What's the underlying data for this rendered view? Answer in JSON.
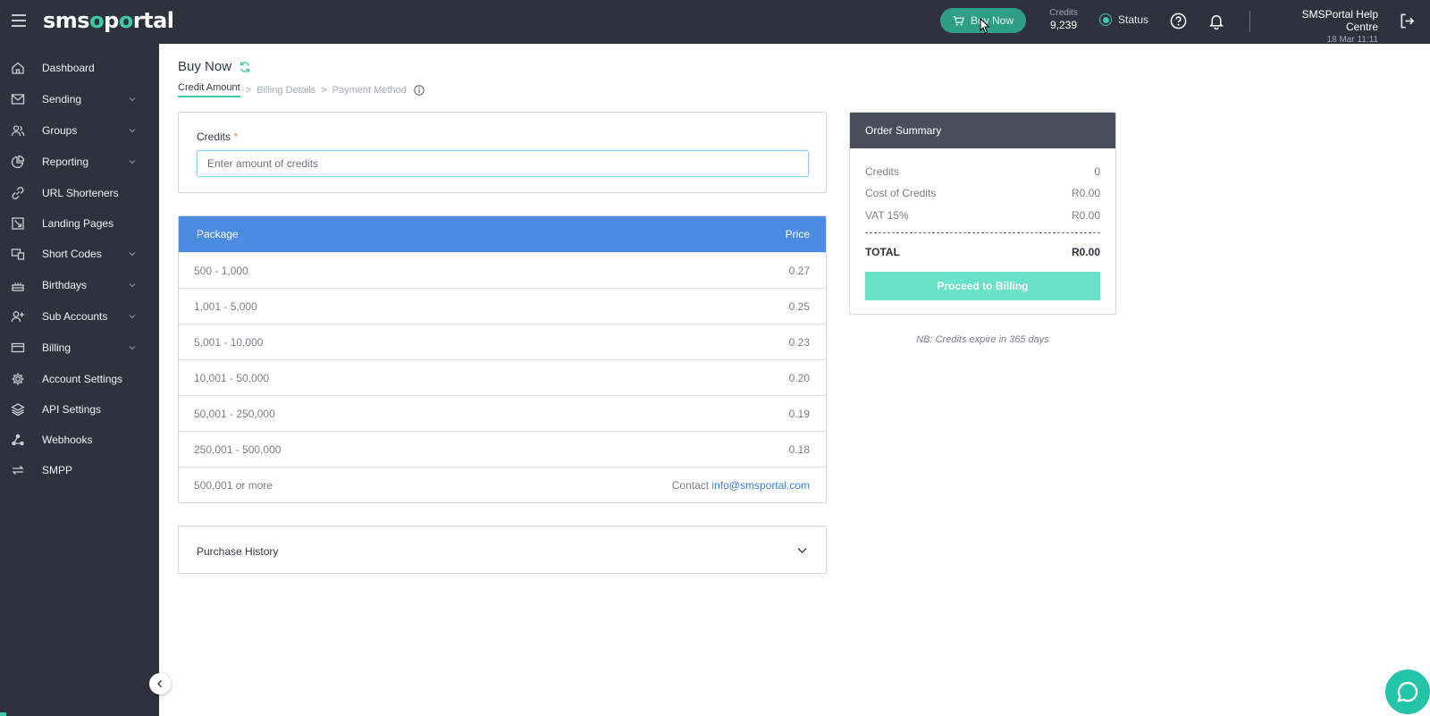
{
  "header": {
    "logo_left": "sms",
    "logo_o": "o",
    "logo_mid": "p",
    "logo_right": "rtal",
    "buy_now_label": "Buy Now",
    "credits_label": "Credits",
    "credits_value": "9,239",
    "status_label": "Status",
    "help_centre_title": "SMSPortal Help Centre",
    "help_centre_date": "18 Mar 11:11"
  },
  "sidebar": {
    "items": [
      {
        "label": "Dashboard",
        "icon": "home-icon",
        "has_children": false
      },
      {
        "label": "Sending",
        "icon": "envelope-icon",
        "has_children": true
      },
      {
        "label": "Groups",
        "icon": "users-icon",
        "has_children": true
      },
      {
        "label": "Reporting",
        "icon": "pie-chart-icon",
        "has_children": true
      },
      {
        "label": "URL Shorteners",
        "icon": "link-icon",
        "has_children": false
      },
      {
        "label": "Landing Pages",
        "icon": "landing-page-icon",
        "has_children": false
      },
      {
        "label": "Short Codes",
        "icon": "short-codes-icon",
        "has_children": true
      },
      {
        "label": "Birthdays",
        "icon": "cake-icon",
        "has_children": true
      },
      {
        "label": "Sub Accounts",
        "icon": "user-plus-icon",
        "has_children": true
      },
      {
        "label": "Billing",
        "icon": "credit-card-icon",
        "has_children": true
      },
      {
        "label": "Account Settings",
        "icon": "gear-icon",
        "has_children": false
      },
      {
        "label": "API Settings",
        "icon": "layers-icon",
        "has_children": false
      },
      {
        "label": "Webhooks",
        "icon": "webhooks-icon",
        "has_children": false
      },
      {
        "label": "SMPP",
        "icon": "swap-icon",
        "has_children": false
      }
    ]
  },
  "page": {
    "title": "Buy Now",
    "steps": [
      "Credit Amount",
      "Billing Details",
      "Payment Method"
    ],
    "separator": ">",
    "active_step": 0
  },
  "credits_form": {
    "label": "Credits",
    "required_mark": "*",
    "placeholder": "Enter amount of credits",
    "value": ""
  },
  "packages": {
    "header_package": "Package",
    "header_price": "Price",
    "rows": [
      {
        "range": "500 - 1,000",
        "price": "0.27"
      },
      {
        "range": "1,001 - 5,000",
        "price": "0.25"
      },
      {
        "range": "5,001 - 10,000",
        "price": "0.23"
      },
      {
        "range": "10,001 - 50,000",
        "price": "0.20"
      },
      {
        "range": "50,001 - 250,000",
        "price": "0.19"
      },
      {
        "range": "250,001 - 500,000",
        "price": "0.18"
      }
    ],
    "last_row": {
      "range": "500,001 or more",
      "contact_prefix": "Contact",
      "email": "info@smsportal.com"
    }
  },
  "purchase_history": {
    "label": "Purchase History"
  },
  "order_summary": {
    "title": "Order Summary",
    "rows": [
      {
        "label": "Credits",
        "value": "0"
      },
      {
        "label": "Cost of Credits",
        "value": "R0.00"
      },
      {
        "label": "VAT 15%",
        "value": "R0.00"
      }
    ],
    "total_label": "TOTAL",
    "total_value": "R0.00",
    "proceed_label": "Proceed to Billing",
    "note": "NB: Credits expire in 365 days"
  },
  "colors": {
    "sidebar_bg": "#2f323d",
    "accent_green": "#3ec9a7",
    "table_header_blue": "#4b8be2",
    "proceed_button": "#69e3c7"
  }
}
